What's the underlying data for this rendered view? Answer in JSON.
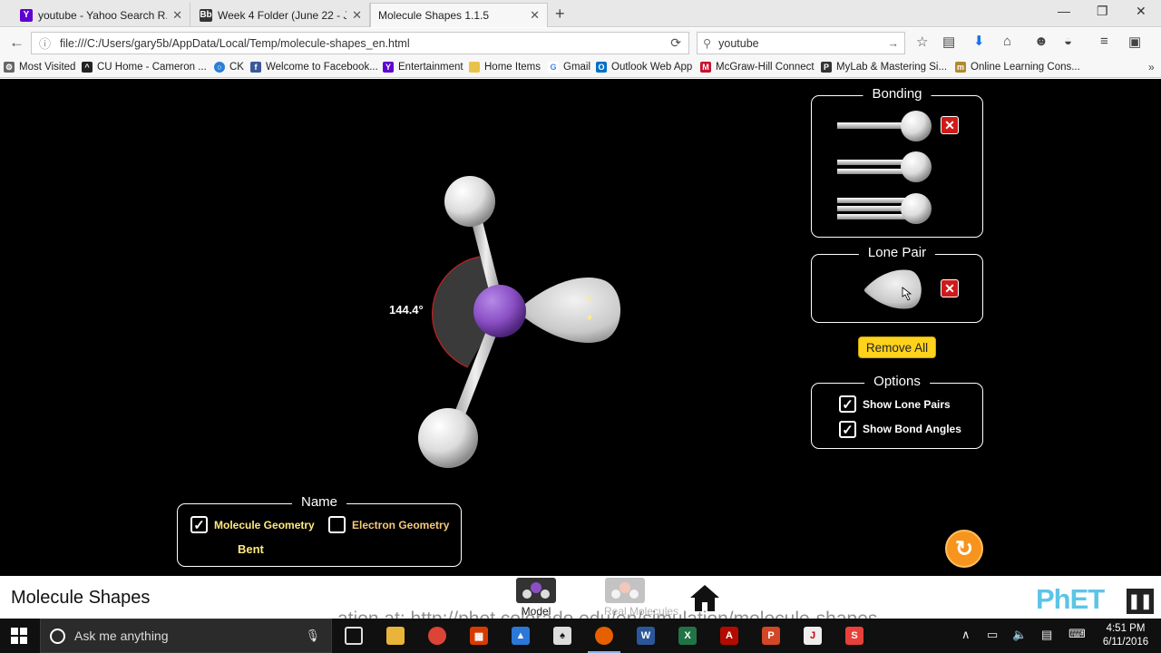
{
  "browser": {
    "tabs": [
      {
        "title": "youtube - Yahoo Search R...",
        "icon": "yahoo-icon",
        "color": "#5f01d1"
      },
      {
        "title": "Week 4 Folder (June 22 - J...",
        "icon": "blackboard-icon",
        "color": "#333333"
      },
      {
        "title": "Molecule Shapes 1.1.5",
        "icon": "",
        "color": "",
        "active": true
      }
    ],
    "url": "file:///C:/Users/gary5b/AppData/Local/Temp/molecule-shapes_en.html",
    "search_value": "youtube",
    "bookmarks": [
      {
        "label": "Most Visited",
        "icon": "gear-icon"
      },
      {
        "label": "CU Home - Cameron ...",
        "icon": "cu-icon"
      },
      {
        "label": "CK",
        "icon": "ck-icon"
      },
      {
        "label": "Welcome to Facebook...",
        "icon": "facebook-icon"
      },
      {
        "label": "Entertainment",
        "icon": "yahoo-icon"
      },
      {
        "label": "Home Items",
        "icon": "folder-icon"
      },
      {
        "label": "Gmail",
        "icon": "google-icon"
      },
      {
        "label": "Outlook Web App",
        "icon": "outlook-icon"
      },
      {
        "label": "McGraw-Hill Connect",
        "icon": "mcgraw-hill-icon"
      },
      {
        "label": "MyLab & Mastering Si...",
        "icon": "pearson-icon"
      },
      {
        "label": "Online Learning Cons...",
        "icon": "mn-icon"
      }
    ]
  },
  "sim": {
    "bonding": {
      "title": "Bonding",
      "items": [
        "single-bond",
        "double-bond",
        "triple-bond"
      ]
    },
    "lone_pair": {
      "title": "Lone Pair"
    },
    "remove_all_label": "Remove All",
    "options": {
      "title": "Options",
      "show_lone_pairs": {
        "label": "Show Lone Pairs",
        "checked": true
      },
      "show_bond_angles": {
        "label": "Show Bond Angles",
        "checked": true
      }
    },
    "name_panel": {
      "title": "Name",
      "molecule_geometry": {
        "label": "Molecule Geometry",
        "checked": true
      },
      "electron_geometry": {
        "label": "Electron Geometry",
        "checked": false
      },
      "geometry_value": "Bent"
    },
    "bond_angle": "144.4°",
    "colors": {
      "central_atom": "#8a4fc4",
      "label_yellow": "#ffe97f",
      "remove_all_bg": "#ffd21c",
      "reset": "#f7941d"
    }
  },
  "phet_nav": {
    "sim_title": "Molecule Shapes",
    "screens": [
      {
        "label": "Model",
        "selected": true
      },
      {
        "label": "Real Molecules",
        "selected": false
      }
    ],
    "logo": "PhET",
    "ghost_text": "ation at:  http://phet.colorado.edu/en/simulation/molecule-shapes"
  },
  "taskbar": {
    "search_placeholder": "Ask me anything",
    "time": "4:51 PM",
    "date": "6/11/2016"
  }
}
